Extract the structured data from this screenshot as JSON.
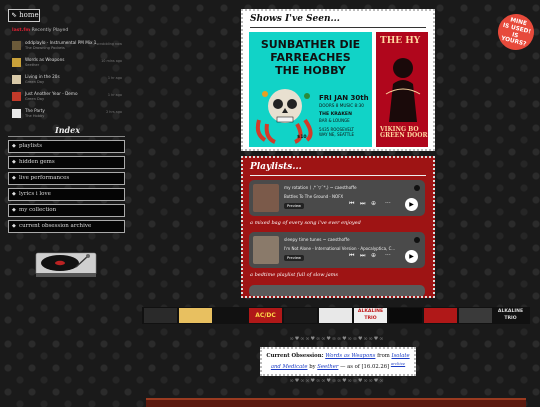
{
  "nav": {
    "home_label": "⇖ home"
  },
  "lastfm": {
    "brand": "last.fm",
    "heading": "Recently Played",
    "tracks": [
      {
        "title": "oddplaylo - Instrumental PM Mix 1",
        "artist": "The Drowning Pockets",
        "time": "♪ scrobbling now",
        "art_color": "#6b5a3a"
      },
      {
        "title": "Words as Weapons",
        "artist": "Seether",
        "time": "10 mins ago",
        "art_color": "#c9a13a"
      },
      {
        "title": "Living in the 20s",
        "artist": "Green Day",
        "time": "1 hr ago",
        "art_color": "#d8c9a8"
      },
      {
        "title": "Just Another Year - Demo",
        "artist": "Green Day",
        "time": "1 hr ago",
        "art_color": "#c23a2a"
      },
      {
        "title": "The Party",
        "artist": "The Hobby",
        "time": "2 hrs ago",
        "art_color": "#e8e8e8"
      }
    ]
  },
  "index": {
    "title": "Index",
    "items": [
      "playlists",
      "hidden gems",
      "live performances",
      "lyrics i love",
      "my collection",
      "current obsession archive"
    ]
  },
  "shows": {
    "title": "Shows I've Seen...",
    "poster1": {
      "bands": [
        "SUNBATHER DIE",
        "FARREACHES",
        "THE HOBBY"
      ],
      "date": "FRI JAN 30th",
      "doors": "DOORS 8 MUSIC 8:30",
      "venue": "THE KRAKEN",
      "venue2": "BAR & LOUNGE",
      "address": "5435 ROOSEVELT",
      "city": "WAY NE, SEATTLE",
      "price": "$10"
    },
    "poster2": {
      "top": "THE HY",
      "bottom": "VIKING BO\nGREEN DOORS"
    }
  },
  "sticker": {
    "lines": [
      "MINE",
      "IS USED!",
      "IS",
      "YOURS?"
    ]
  },
  "playlists": {
    "title": "Playlists...",
    "embeds": [
      {
        "name": "my rotation ( ,*´▽`*,) ~ caesthoffe",
        "track": "Bottles To The Ground · NOFX",
        "preview": "Preview",
        "art_color": "#7b5a4a",
        "desc": "a mixed bag of every song i've ever enjoyed"
      },
      {
        "name": "sleepy time tunes ~ caesthoffe",
        "track": "I'm Not Alone - International Version · Apocalyptica, C...",
        "preview": "Preview",
        "art_color": "#8a7a6a",
        "desc": "a bedtime playlist full of slow jams"
      }
    ]
  },
  "strip": {
    "thumbs": [
      {
        "label": "",
        "bg": "#2a2a2a",
        "fg": "#ccc"
      },
      {
        "label": "",
        "bg": "#e8c060",
        "fg": "#111"
      },
      {
        "label": "",
        "bg": "#111",
        "fg": "#ccc"
      },
      {
        "label": "AC/DC",
        "bg": "#b01818",
        "fg": "#ffd84a"
      },
      {
        "label": "",
        "bg": "#1a1a1a",
        "fg": "#ccc"
      },
      {
        "label": "",
        "bg": "#e8e8e8",
        "fg": "#111"
      },
      {
        "label": "ALKALINE TRIO",
        "bg": "#f0f0f0",
        "fg": "#c01818"
      },
      {
        "label": "",
        "bg": "#0a0a0a",
        "fg": "#c01818"
      },
      {
        "label": "",
        "bg": "#b01818",
        "fg": "#111"
      },
      {
        "label": "",
        "bg": "#3a3a3a",
        "fg": "#ccc"
      },
      {
        "label": "ALKALINE TRIO",
        "bg": "#111",
        "fg": "#ddd"
      }
    ]
  },
  "ornament": "∞♥∞∞♥∞∞♥∞∞♥∞∞♥∞∞♥∞",
  "obsession": {
    "label": "Current Obsession:",
    "song": "Words as Weapons",
    "from": "from",
    "album": "Isolate and Medicate",
    "by": "by",
    "artist": "Seether",
    "asof": "— as of [16.02.26]",
    "archive": "archive"
  }
}
